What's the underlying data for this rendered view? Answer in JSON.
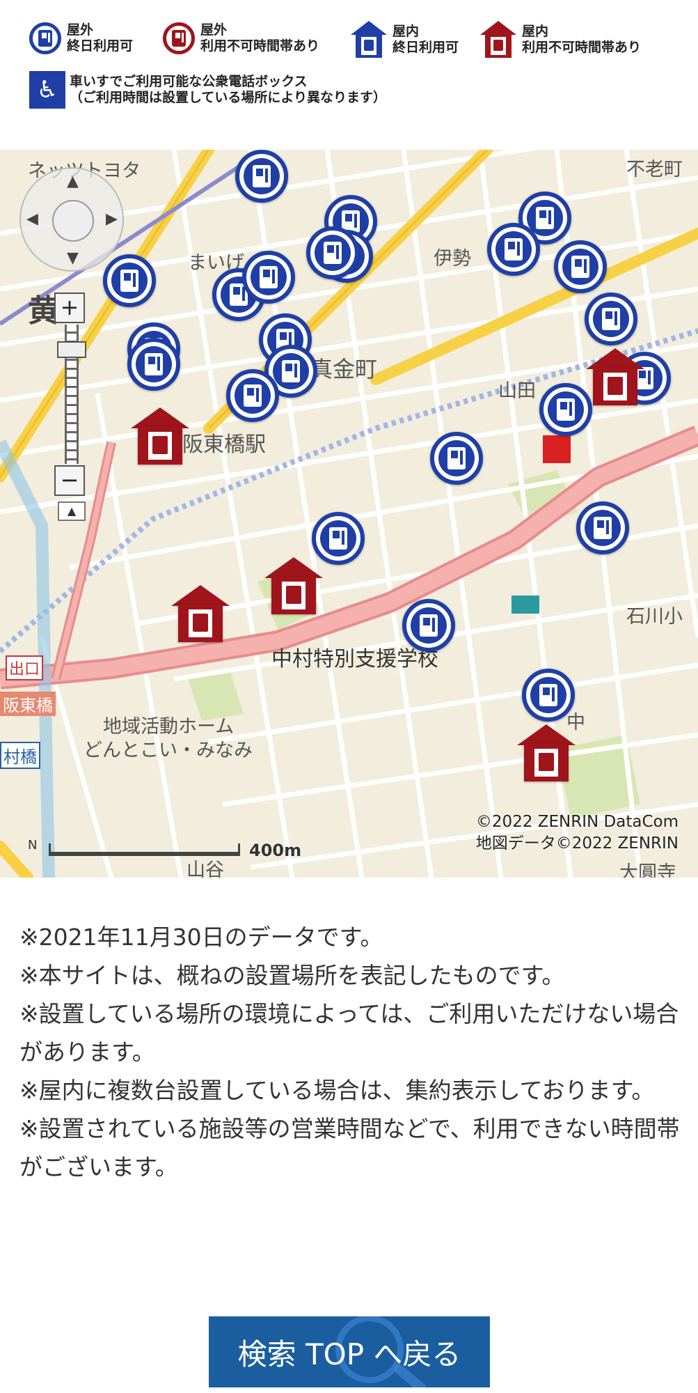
{
  "legend": {
    "outdoor_allday_line1": "屋外",
    "outdoor_allday_line2": "終日利用可",
    "outdoor_limited_line1": "屋外",
    "outdoor_limited_line2": "利用不可時間帯あり",
    "indoor_allday_line1": "屋内",
    "indoor_allday_line2": "終日利用可",
    "indoor_limited_line1": "屋内",
    "indoor_limited_line2": "利用不可時間帯あり",
    "wheelchair_line1": "車いすでご利用可能な公衆電話ボックス",
    "wheelchair_line2": "（ご利用時間は設置している場所により異なります）"
  },
  "map": {
    "labels": {
      "toyota": "ネッツトヨタ",
      "oimachi": "黄",
      "maiji": "まいげ",
      "ise": "伊勢",
      "magane": "真金町",
      "yamada": "山田",
      "bando_station": "阪東橋駅",
      "nakamura_school": "中村特別支援学校",
      "community": "地域活動ホーム",
      "community2": "どんとこい・みなみ",
      "ishikawa": "石川小",
      "naka": "中",
      "deguchi": "出口",
      "bando": "阪東橋",
      "mura": "村橋",
      "yamaya": "山谷",
      "rosho": "不老町",
      "daienji": "大圓寺"
    },
    "copyright_line1": "©2022 ZENRIN DataCom",
    "copyright_line2": "地図データ©2022 ZENRIN",
    "scale_label": "400m",
    "north_label": "N"
  },
  "notes": [
    "※2021年11月30日のデータです。",
    "※本サイトは、概ねの設置場所を表記したものです。",
    "※設置している場所の環境によっては、ご利用いただけない場合があります。",
    "※屋内に複数台設置している場合は、集約表示しております。",
    "※設置されている施設等の営業時間などで、利用できない時間帯がございます。"
  ],
  "button_label": "検索 TOP へ戻る",
  "colors": {
    "blue": "#1f3fa6",
    "red": "#a0141c",
    "button": "#1a5ea0"
  }
}
